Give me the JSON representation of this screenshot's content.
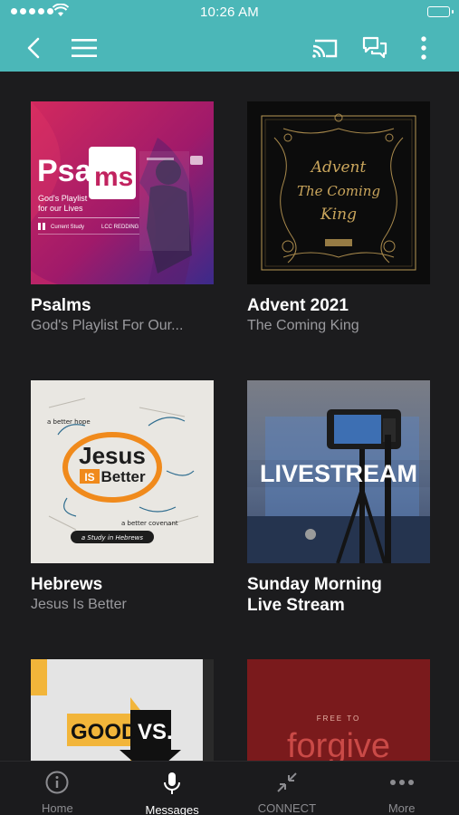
{
  "status_bar": {
    "time": "10:26 AM"
  },
  "cards": [
    {
      "title": "Psalms",
      "subtitle": "God's Playlist For Our...",
      "art": {
        "word_left": "Psa",
        "word_right": "ms",
        "tagline_1": "God's Playlist",
        "tagline_2": "for our Lives",
        "footer_1": "Current Study",
        "footer_2": "LCC REDDING"
      }
    },
    {
      "title": "Advent 2021",
      "subtitle": "The Coming King",
      "art": {
        "line_1": "Advent",
        "line_2": "The Coming",
        "line_3": "King"
      }
    },
    {
      "title": "Hebrews",
      "subtitle": "Jesus Is Better",
      "art": {
        "word_1": "Jesus",
        "word_2": "IS",
        "word_3": "Better",
        "note_1": "a better hope",
        "note_2": "a better covenant",
        "note_3": "a Study in Hebrews"
      }
    },
    {
      "title": "Sunday Morning",
      "title_line_2": "Live Stream",
      "subtitle": "",
      "art": {
        "banner": "LIVESTREAM"
      }
    },
    {
      "title": "",
      "subtitle": "",
      "art": {
        "word_1": "GOOD",
        "word_2": "VS."
      }
    },
    {
      "title": "",
      "subtitle": "",
      "art": {
        "small": "FREE TO",
        "big": "forgive"
      }
    }
  ],
  "tabs": [
    {
      "label": "Home",
      "icon": "info-icon"
    },
    {
      "label": "Messages",
      "icon": "microphone-icon"
    },
    {
      "label": "CONNECT",
      "icon": "arrows-inward-icon"
    },
    {
      "label": "More",
      "icon": "more-dots-icon"
    }
  ],
  "colors": {
    "header": "#4bb7b8",
    "background": "#1c1c1e"
  }
}
